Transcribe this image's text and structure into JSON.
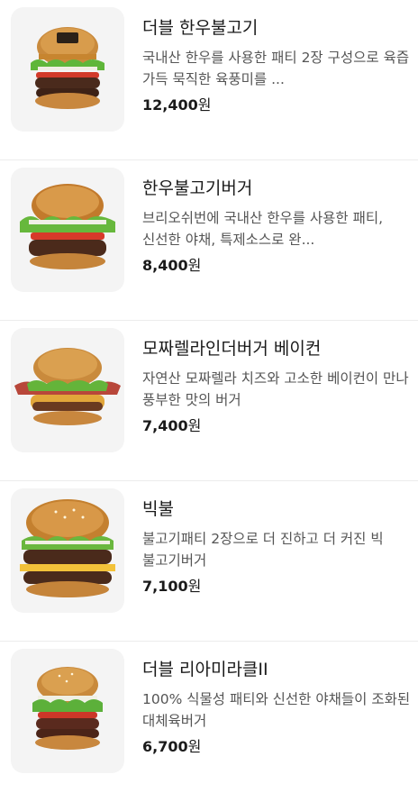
{
  "menu": {
    "items": [
      {
        "name": "더블 한우불고기",
        "description": "국내산 한우를 사용한 패티 2장 구성으로 육즙 가득 묵직한 육풍미를 ...",
        "price": "12,400",
        "currency": "원",
        "image_icon": "double-hanwoo-bulgogi-burger-icon"
      },
      {
        "name": "한우불고기버거",
        "description": "브리오쉬번에 국내산 한우를 사용한 패티, 신선한 야채, 특제소스로 완...",
        "price": "8,400",
        "currency": "원",
        "image_icon": "hanwoo-bulgogi-burger-icon"
      },
      {
        "name": "모짜렐라인더버거 베이컨",
        "description": "자연산 모짜렐라 치즈와 고소한 베이컨이 만나 풍부한 맛의 버거",
        "price": "7,400",
        "currency": "원",
        "image_icon": "mozzarella-bacon-burger-icon"
      },
      {
        "name": "빅불",
        "description": "불고기패티 2장으로 더 진하고 더 커진 빅 불고기버거",
        "price": "7,100",
        "currency": "원",
        "image_icon": "big-bull-burger-icon"
      },
      {
        "name": "더블 리아미라클II",
        "description": "100% 식물성 패티와 신선한 야채들이 조화된 대체육버거",
        "price": "6,700",
        "currency": "원",
        "image_icon": "double-miracle-burger-icon"
      }
    ]
  }
}
